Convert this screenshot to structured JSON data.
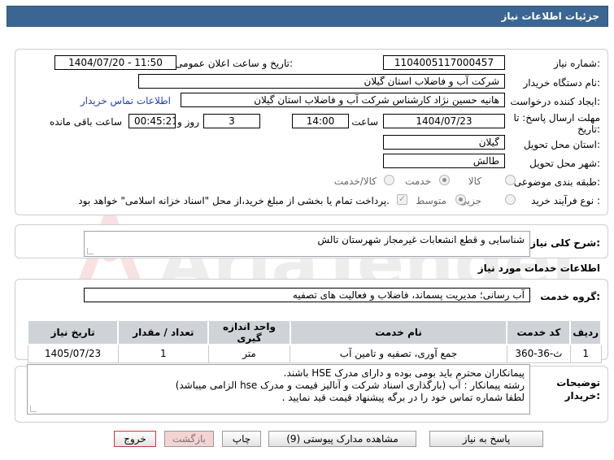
{
  "header": {
    "title": "جزئيات اطلاعات نياز"
  },
  "form": {
    "need_number_label": "شماره نیاز:",
    "need_number": "1104005117000457",
    "announce_label": "تاریخ و ساعت اعلان عمومی:",
    "announce_value": "1404/07/20 - 11:50",
    "buyer_label": "نام دستگاه خریدار:",
    "buyer_value": "شرکت آب و فاضلاب استان گیلان",
    "creator_label": "ایجاد کننده درخواست:",
    "creator_value": "هانیه حسین نژاد کارشناس شرکت آب و فاضلاب استان گیلان",
    "contact_link": "اطلاعات تماس خریدار",
    "deadline_label_1": "مهلت ارسال پاسخ: تا",
    "deadline_label_2": "تاریخ:",
    "deadline_date": "1404/07/23",
    "time_label": "ساعت",
    "deadline_time": "14:00",
    "days_value": "3",
    "days_label": "روز و",
    "remaining_value": "00:45:21",
    "remaining_label": "ساعت باقی مانده",
    "province_label": "استان محل تحویل:",
    "province_value": "گیلان",
    "city_label": "شهر محل تحویل:",
    "city_value": "طالش",
    "category_label": "طبقه بندی موضوعی:",
    "category_options": [
      "کالا",
      "خدمت",
      "کالا/خدمت"
    ],
    "process_label": "نوع فرآیند خرید :",
    "process_options": [
      "جزیی",
      "متوسط"
    ],
    "payment_note": "پرداخت تمام یا بخشی از مبلغ خرید،از محل \"اسناد خزانه اسلامی\" خواهد بود."
  },
  "summary": {
    "label": "شرح کلی نیاز:",
    "value": "شناسایی و قطع انشعابات غیرمجاز شهرستان تالش"
  },
  "services": {
    "section_title": "اطلاعات خدمات مورد نیاز",
    "group_label": "گروه خدمت:",
    "group_value": "آب رسانی؛ مدیریت پسماند، فاضلاب و فعالیت های تصفیه",
    "columns": [
      "ردیف",
      "کد خدمت",
      "نام خدمت",
      "واحد اندازه گیری",
      "تعداد / مقدار",
      "تاریخ نیاز"
    ],
    "rows": [
      [
        "1",
        "ث-36-360",
        "جمع آوری، تصفیه و تامین آب",
        "متر",
        "1",
        "1405/07/23"
      ]
    ]
  },
  "notes": {
    "label_1": "توضیحات",
    "label_2": "خریدار:",
    "line_1": "پیمانکاران محترم باید بومی بوده و  دارای مدرک HSE باشند.",
    "line_2": "رشته پیمانکار :    آب  (بارگذاری اسناد شرکت و آنالیز قیمت و مدرک hse الزامی میباشد)",
    "line_3": "لطفا شماره تماس خود را در برگه پیشنهاد قیمت قید نمایید ."
  },
  "buttons": {
    "reply": "پاسخ به نیاز",
    "docs": "مشاهده مدارک پیوستی (9)",
    "print": "چاپ",
    "back": "بازگشت",
    "exit": "خروج"
  },
  "colors": {
    "header_bg": "#3b6693",
    "link": "#1a3fc0",
    "exit_border": "#c8373d"
  }
}
